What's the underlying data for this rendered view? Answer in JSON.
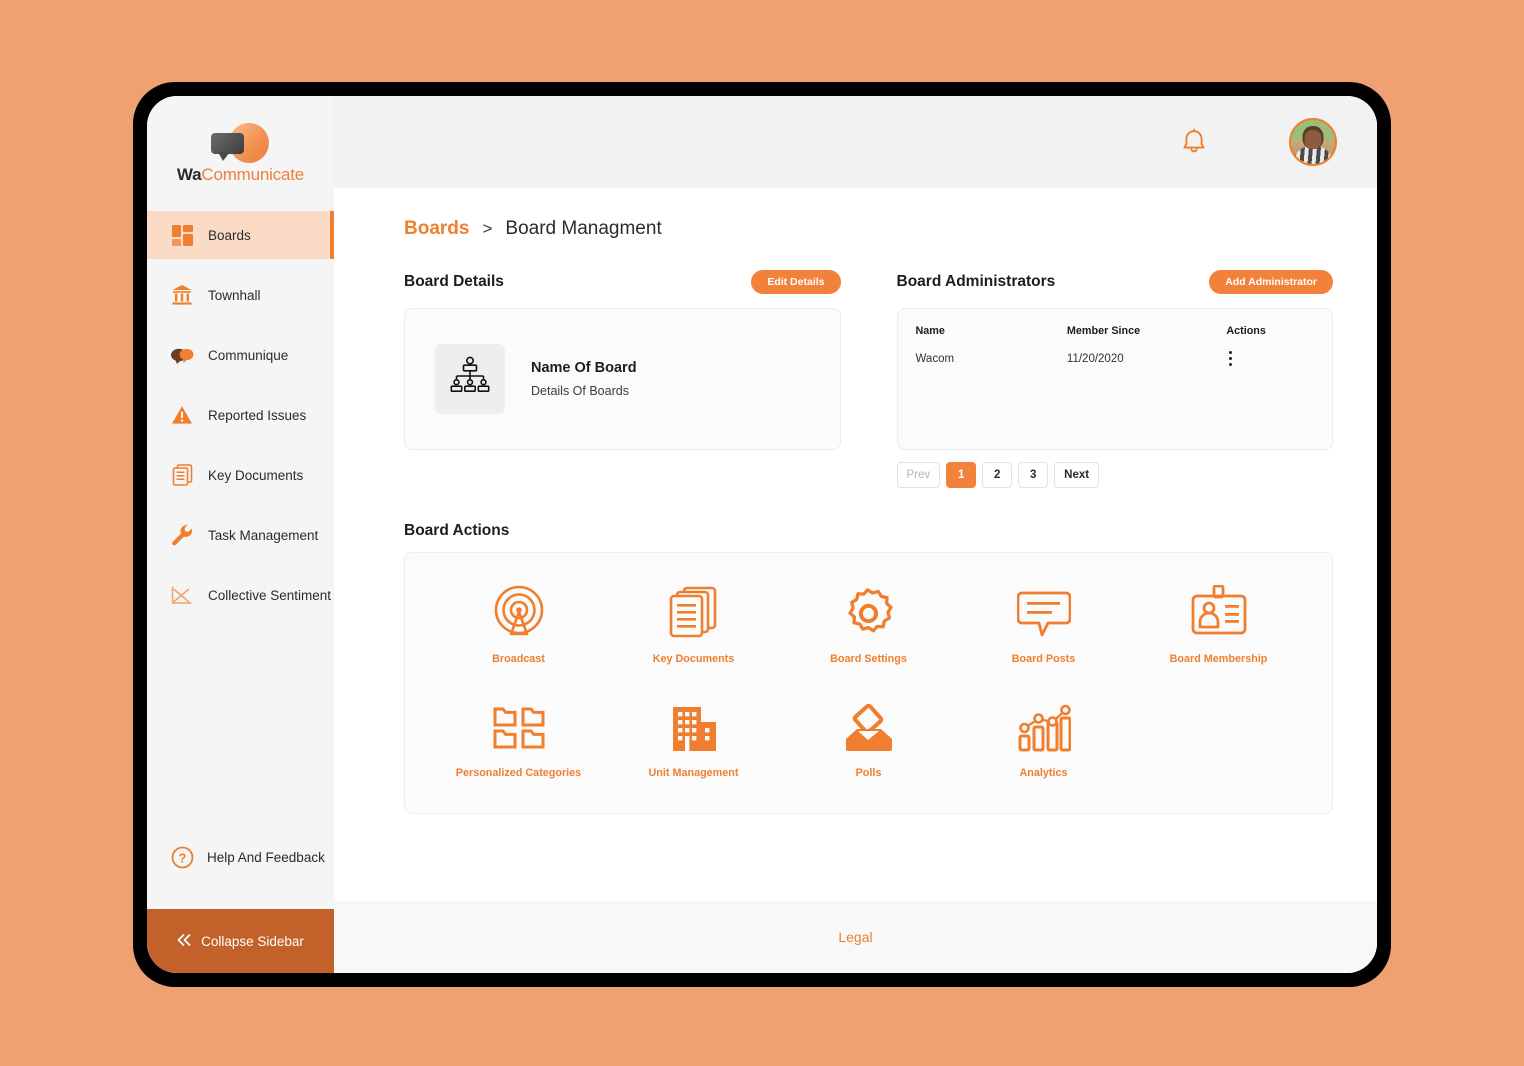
{
  "brand": {
    "name_primary": "Wa",
    "name_secondary": "Communicate",
    "accent": "#ef7f2e",
    "accent_dark": "#c2612a",
    "page_background": "#f0a172"
  },
  "sidebar": {
    "items": [
      {
        "label": "Boards",
        "icon": "boards-grid-icon",
        "active": true
      },
      {
        "label": "Townhall",
        "icon": "bank-icon",
        "active": false
      },
      {
        "label": "Communique",
        "icon": "chat-bubbles-icon",
        "active": false
      },
      {
        "label": "Reported Issues",
        "icon": "warning-triangle-icon",
        "active": false
      },
      {
        "label": "Key Documents",
        "icon": "documents-icon",
        "active": false
      },
      {
        "label": "Task Management",
        "icon": "wrench-icon",
        "active": false
      },
      {
        "label": "Collective Sentiment",
        "icon": "line-chart-icon",
        "active": false
      }
    ],
    "help": {
      "label": "Help And Feedback",
      "icon": "question-circle-icon"
    },
    "collapse": {
      "label": "Collapse Sidebar",
      "icon": "double-chevron-left-icon"
    }
  },
  "topbar": {
    "notifications_icon": "bell-icon",
    "apps_icon": "grid-apps-icon",
    "avatar_alt": "user-avatar"
  },
  "breadcrumb": {
    "parent": "Boards",
    "separator": ">",
    "current": "Board Managment"
  },
  "board_details": {
    "title": "Board Details",
    "edit_button": "Edit Details",
    "thumb_icon": "org-chart-icon",
    "name": "Name Of Board",
    "subtitle": "Details Of Boards"
  },
  "administrators": {
    "title": "Board Administrators",
    "add_button": "Add Administrator",
    "columns": [
      "Name",
      "Member Since",
      "Actions"
    ],
    "rows": [
      {
        "name": "Wacom",
        "member_since": "11/20/2020",
        "actions_icon": "kebab-menu-icon"
      }
    ],
    "pagination": {
      "prev": "Prev",
      "pages": [
        "1",
        "2",
        "3"
      ],
      "current": "1",
      "next": "Next"
    }
  },
  "board_actions": {
    "title": "Board Actions",
    "row1": [
      {
        "label": "Broadcast",
        "icon": "broadcast-icon"
      },
      {
        "label": "Key Documents",
        "icon": "documents-icon"
      },
      {
        "label": "Board Settings",
        "icon": "gear-icon"
      },
      {
        "label": "Board Posts",
        "icon": "speech-bubble-icon"
      },
      {
        "label": "Board Membership",
        "icon": "id-card-icon"
      }
    ],
    "row2": [
      {
        "label": "Personalized Categories",
        "icon": "folders-grid-icon"
      },
      {
        "label": "Unit Management",
        "icon": "building-icon"
      },
      {
        "label": "Polls",
        "icon": "ballot-box-icon"
      },
      {
        "label": "Analytics",
        "icon": "bar-chart-icon"
      }
    ]
  },
  "footer": {
    "legal": "Legal"
  }
}
